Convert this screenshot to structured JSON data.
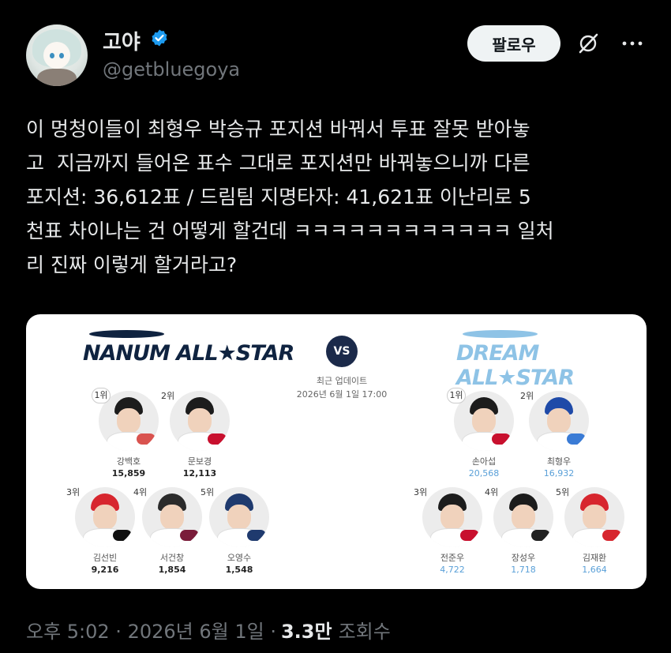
{
  "author": {
    "display_name": "고야",
    "handle": "@getbluegoya"
  },
  "actions": {
    "follow_label": "팔로우"
  },
  "tweet": {
    "text": "이 멍청이들이 최형우 박승규 포지션 바꿔서 투표 잘못 받아놓\n고  지금까지 들어온 표수 그대로 포지션만 바꿔놓으니까 다른\n포지션: 36,612표 / 드림팀 지명타자: 41,621표 이난리로 5\n천표 차이나는 건 어떻게 할건데 ㅋㅋㅋㅋㅋㅋㅋㅋㅋㅋㅋㅋ 일처\n리 진짜 이렇게 할거라고?"
  },
  "card": {
    "nanum_logo": "NANUM ALL★STAR",
    "dream_logo": "DREAM ALL★STAR",
    "vs": "VS",
    "update_label": "최근 업데이트",
    "update_time": "2026년 6월 1일 17:00",
    "nanum_players": [
      {
        "rank": "1위",
        "name": "강백호",
        "votes": "15,859"
      },
      {
        "rank": "2위",
        "name": "문보경",
        "votes": "12,113"
      },
      {
        "rank": "3위",
        "name": "김선빈",
        "votes": "9,216"
      },
      {
        "rank": "4위",
        "name": "서건창",
        "votes": "1,854"
      },
      {
        "rank": "5위",
        "name": "오영수",
        "votes": "1,548"
      }
    ],
    "dream_players": [
      {
        "rank": "1위",
        "name": "손아섭",
        "votes": "20,568"
      },
      {
        "rank": "2위",
        "name": "최형우",
        "votes": "16,932"
      },
      {
        "rank": "3위",
        "name": "전준우",
        "votes": "4,722"
      },
      {
        "rank": "4위",
        "name": "장성우",
        "votes": "1,718"
      },
      {
        "rank": "5위",
        "name": "김재환",
        "votes": "1,664"
      }
    ]
  },
  "footer": {
    "time_date": "오후 5:02 · 2026년 6월 1일 ·",
    "views_count": "3.3만",
    "views_label": "조회수"
  },
  "colors": {
    "background": "#000000",
    "text": "#e7e9ea",
    "muted": "#71767b",
    "verified": "#1d9bf0",
    "nanum_navy": "#0f2340",
    "dream_blue": "#8ec3e6"
  }
}
